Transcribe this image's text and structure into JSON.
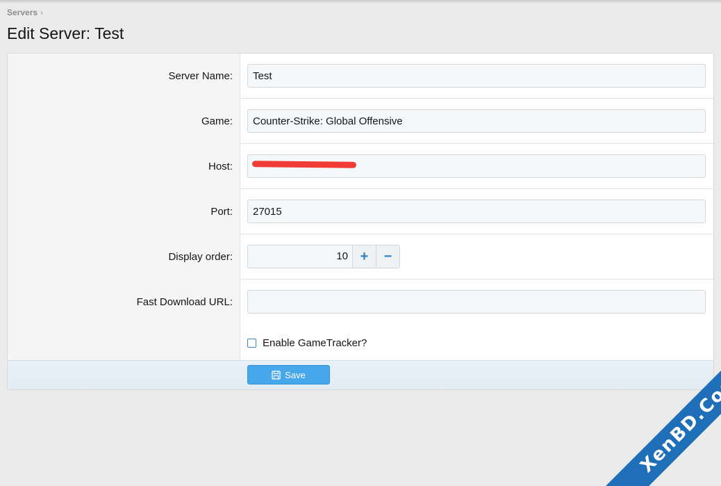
{
  "breadcrumb": {
    "item": "Servers",
    "separator": "›"
  },
  "page": {
    "title": "Edit Server: Test"
  },
  "form": {
    "server_name": {
      "label": "Server Name:",
      "value": "Test"
    },
    "game": {
      "label": "Game:",
      "value": "Counter-Strike: Global Offensive"
    },
    "host": {
      "label": "Host:",
      "value": ""
    },
    "port": {
      "label": "Port:",
      "value": "27015"
    },
    "display_order": {
      "label": "Display order:",
      "value": "10",
      "plus": "+",
      "minus": "−"
    },
    "fast_download_url": {
      "label": "Fast Download URL:",
      "value": ""
    },
    "enable_gametracker": {
      "label": "Enable GameTracker?",
      "checked": false
    }
  },
  "footer": {
    "save_label": "Save"
  },
  "watermark": {
    "text": "XenBD.Com"
  },
  "colors": {
    "accent": "#47a7eb",
    "stepper_icon": "#2b80c6",
    "redaction": "#f0302a",
    "watermark": "#1f6fb8"
  }
}
